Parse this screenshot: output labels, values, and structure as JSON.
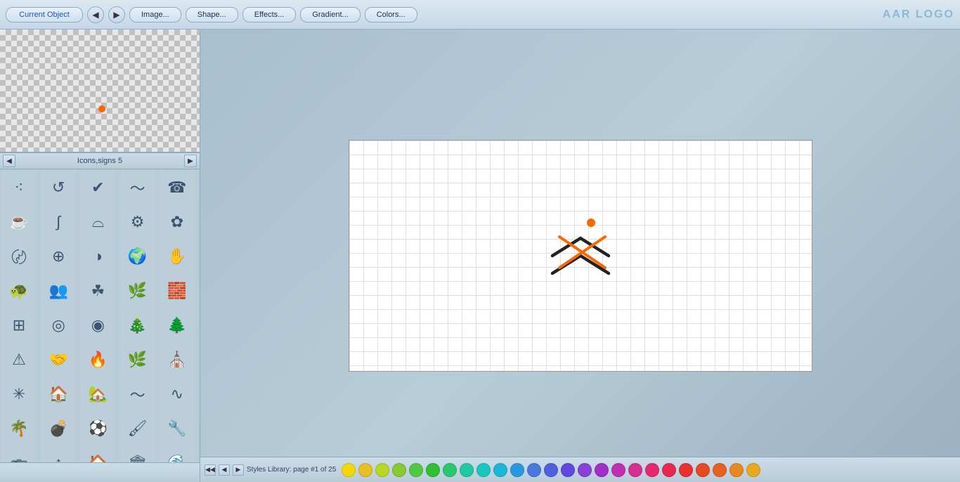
{
  "toolbar": {
    "current_object_label": "Current Object",
    "back_icon": "◀",
    "forward_icon": "▶",
    "image_btn": "Image...",
    "shape_btn": "Shape...",
    "effects_btn": "Effects...",
    "gradient_btn": "Gradient...",
    "colors_btn": "Colors...",
    "app_title": "AAR LOGO"
  },
  "icons_panel": {
    "title": "Icons,signs 5",
    "prev_icon": "◀",
    "next_icon": "▶"
  },
  "bottom_bar": {
    "styles_label": "Styles Library: page #1 of 25",
    "prev_icon": "◀",
    "prev2_icon": "◀◀",
    "next_icon": "▶"
  },
  "colors": [
    "#f5d800",
    "#e8c020",
    "#b8d820",
    "#88c830",
    "#50c840",
    "#30c030",
    "#28c870",
    "#20c8a0",
    "#18c8c0",
    "#18b8d8",
    "#2898e0",
    "#4878e0",
    "#5060e0",
    "#6048e0",
    "#8840d8",
    "#a030c8",
    "#c030b0",
    "#d83090",
    "#e82870",
    "#e82850",
    "#e83030",
    "#e84820",
    "#e86020",
    "#e88820",
    "#e8a820"
  ],
  "icons": [
    {
      "symbol": "⁖",
      "name": "decorative-dots"
    },
    {
      "symbol": "↺",
      "name": "circular-arrow"
    },
    {
      "symbol": "✔",
      "name": "checkmark"
    },
    {
      "symbol": "〜",
      "name": "wave"
    },
    {
      "symbol": "☎",
      "name": "telephone"
    },
    {
      "symbol": "☕",
      "name": "coffee-cup"
    },
    {
      "symbol": "∫",
      "name": "snake-curve"
    },
    {
      "symbol": "⌓",
      "name": "bowl"
    },
    {
      "symbol": "⚙",
      "name": "gears"
    },
    {
      "symbol": "✿",
      "name": "flower-swirl"
    },
    {
      "symbol": "〄",
      "name": "spiral-left"
    },
    {
      "symbol": "⊕",
      "name": "no-sign"
    },
    {
      "symbol": "◑",
      "name": "half-circle"
    },
    {
      "symbol": "🌍",
      "name": "globe"
    },
    {
      "symbol": "✋",
      "name": "hand-splat"
    },
    {
      "symbol": "🐢",
      "name": "turtle"
    },
    {
      "symbol": "👥",
      "name": "people"
    },
    {
      "symbol": "☘",
      "name": "clover"
    },
    {
      "symbol": "🌿",
      "name": "plant"
    },
    {
      "symbol": "🧱",
      "name": "brick-wall"
    },
    {
      "symbol": "⊞",
      "name": "calculator"
    },
    {
      "symbol": "◎",
      "name": "spiral1"
    },
    {
      "symbol": "◉",
      "name": "spiral2"
    },
    {
      "symbol": "🎄",
      "name": "xmas-tree"
    },
    {
      "symbol": "🌲",
      "name": "pine-tree"
    },
    {
      "symbol": "⚠",
      "name": "warning-triangle"
    },
    {
      "symbol": "🤝",
      "name": "handshake"
    },
    {
      "symbol": "🔥",
      "name": "fire"
    },
    {
      "symbol": "🌿",
      "name": "flame2"
    },
    {
      "symbol": "⛪",
      "name": "church"
    },
    {
      "symbol": "✳",
      "name": "starburst"
    },
    {
      "symbol": "🏠",
      "name": "house1"
    },
    {
      "symbol": "🏡",
      "name": "house2"
    },
    {
      "symbol": "〜",
      "name": "wonder-woman"
    },
    {
      "symbol": "∿",
      "name": "wonder-woman2"
    },
    {
      "symbol": "🌴",
      "name": "palm-tree"
    },
    {
      "symbol": "💣",
      "name": "bomb"
    },
    {
      "symbol": "⚽",
      "name": "ball-icon"
    },
    {
      "symbol": "🖌",
      "name": "brush"
    },
    {
      "symbol": "🔧",
      "name": "tool"
    },
    {
      "symbol": "🚌",
      "name": "bus"
    },
    {
      "symbol": "↑",
      "name": "arrow-up"
    },
    {
      "symbol": "🏠",
      "name": "house3"
    },
    {
      "symbol": "🏛",
      "name": "building"
    },
    {
      "symbol": "🌊",
      "name": "wave2"
    }
  ]
}
